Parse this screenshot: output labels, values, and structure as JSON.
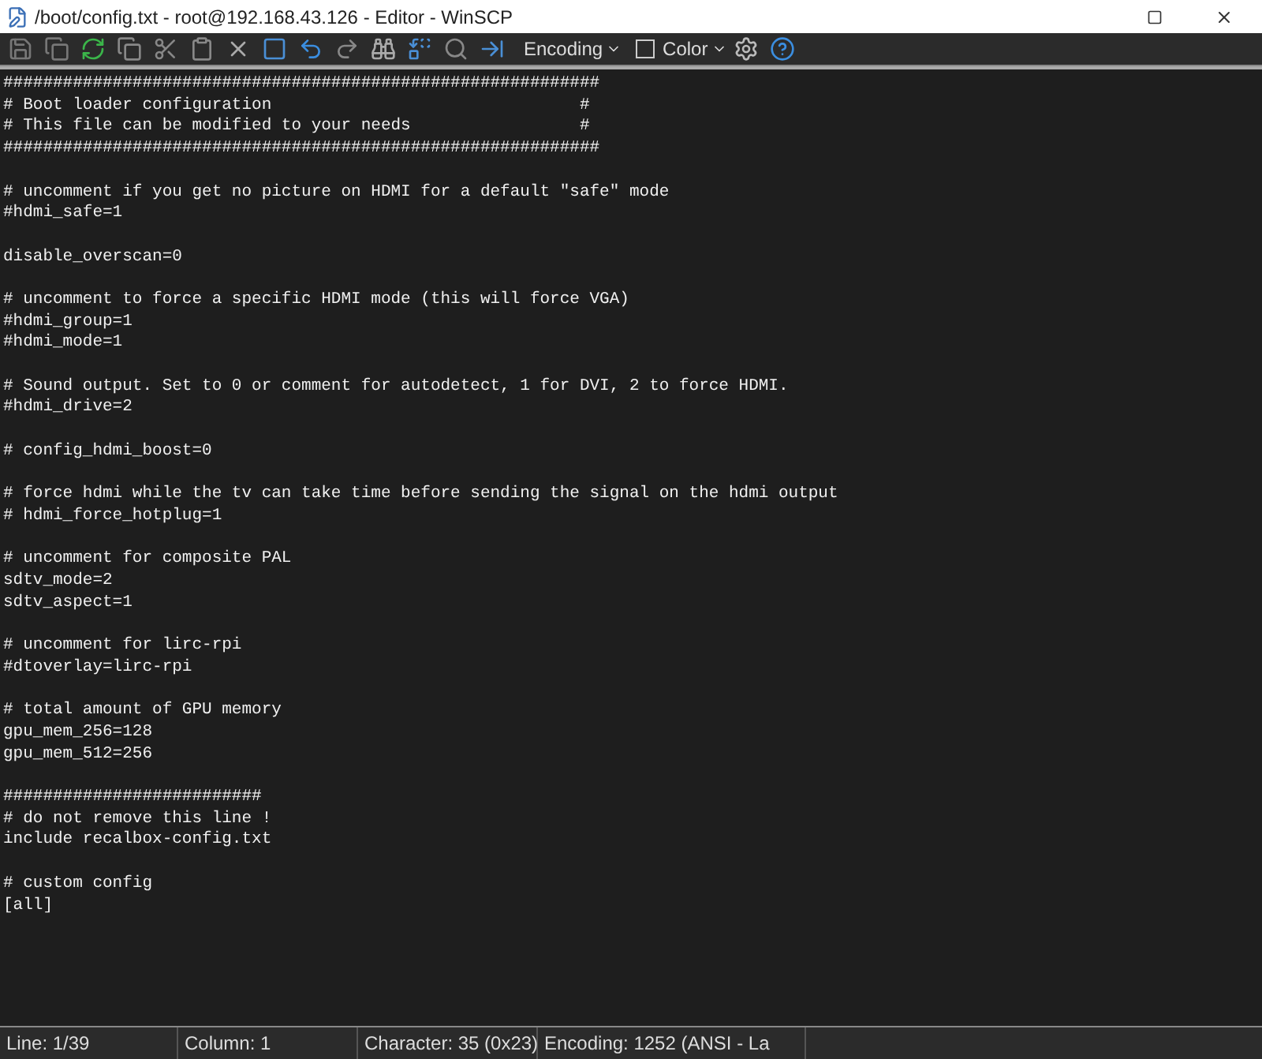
{
  "window": {
    "title": "/boot/config.txt - root@192.168.43.126 - Editor - WinSCP"
  },
  "toolbar": {
    "encoding": "Encoding",
    "color": {
      "label": "Color",
      "checked": false
    }
  },
  "editor": {
    "blocks": [
      [
        "############################################################",
        "# Boot loader configuration                               #",
        "# This file can be modified to your needs                 #",
        "############################################################"
      ],
      [
        "# uncomment if you get no picture on HDMI for a default \"safe\" mode",
        "#hdmi_safe=1"
      ],
      [
        "disable_overscan=0"
      ],
      [
        "# uncomment to force a specific HDMI mode (this will force VGA)",
        "#hdmi_group=1",
        "#hdmi_mode=1"
      ],
      [
        "# Sound output. Set to 0 or comment for autodetect, 1 for DVI, 2 to force HDMI.",
        "#hdmi_drive=2"
      ],
      [
        "# config_hdmi_boost=0"
      ],
      [
        "# force hdmi while the tv can take time before sending the signal on the hdmi output",
        "# hdmi_force_hotplug=1"
      ],
      [
        "# uncomment for composite PAL",
        "sdtv_mode=2",
        "sdtv_aspect=1"
      ],
      [
        "# uncomment for lirc-rpi",
        "#dtoverlay=lirc-rpi"
      ],
      [
        "# total amount of GPU memory",
        "gpu_mem_256=128",
        "gpu_mem_512=256"
      ],
      [
        "##########################",
        "# do not remove this line !",
        "include recalbox-config.txt"
      ],
      [
        "# custom config",
        "[all]"
      ]
    ]
  },
  "status_bar": [
    "Line: 1/39",
    "Column: 1",
    "Character: 35 (0x23)",
    "Encoding: 1252  (ANSI - La"
  ]
}
